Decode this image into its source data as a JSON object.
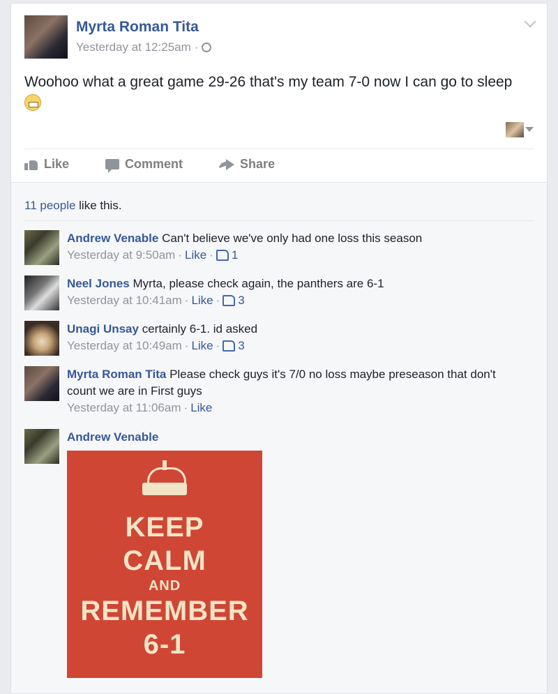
{
  "post": {
    "author": "Myrta Roman Tita",
    "timestamp": "Yesterday at 12:25am",
    "separator": "·",
    "text": "Woohoo what a great game 29-26 that's my team 7-0 now I can go to sleep"
  },
  "actions": {
    "like": "Like",
    "comment": "Comment",
    "share": "Share"
  },
  "likes": {
    "count_link": "11 people",
    "suffix": " like this."
  },
  "comments": [
    {
      "author": "Andrew Venable",
      "text": "Can't believe we've only had one loss this season",
      "time": "Yesterday at 9:50am",
      "like_label": "Like",
      "likes": "1"
    },
    {
      "author": "Neel Jones",
      "text": "Myrta, please check again, the panthers are 6-1",
      "time": "Yesterday at 10:41am",
      "like_label": "Like",
      "likes": "3"
    },
    {
      "author": "Unagi Unsay",
      "text": "certainly 6-1. id asked",
      "time": "Yesterday at 10:49am",
      "like_label": "Like",
      "likes": "3"
    },
    {
      "author": "Myrta Roman Tita",
      "text": "Please check guys it's 7/0 no loss maybe preseason that don't count we are in First guys",
      "time": "Yesterday at 11:06am",
      "like_label": "Like"
    },
    {
      "author": "Andrew Venable"
    }
  ],
  "keep_calm": {
    "line1": "KEEP",
    "line2": "CALM",
    "line3": "AND",
    "line4": "REMEMBER",
    "line5": "6-1"
  },
  "colors": {
    "link": "#365899",
    "meta": "#90949c",
    "poster_bg": "#d04634",
    "poster_text": "#f2e4c7"
  }
}
